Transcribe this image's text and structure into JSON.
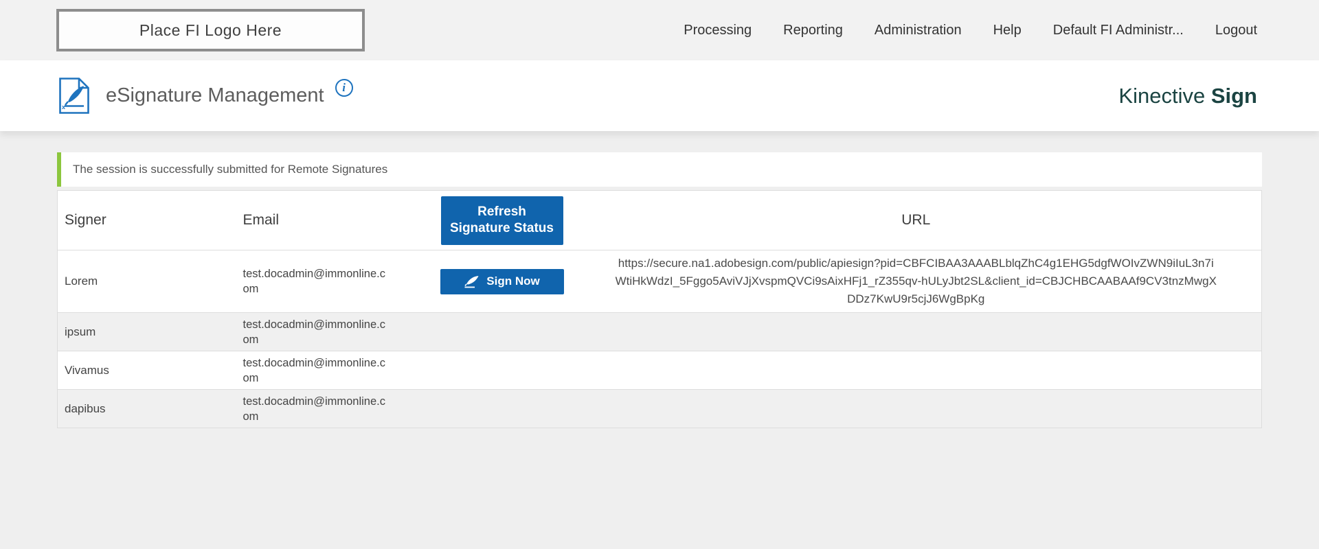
{
  "topbar": {
    "logo_placeholder": "Place FI Logo Here",
    "nav_items": [
      {
        "label": "Processing"
      },
      {
        "label": "Reporting"
      },
      {
        "label": "Administration"
      },
      {
        "label": "Help"
      },
      {
        "label": "Default FI Administr..."
      },
      {
        "label": "Logout"
      }
    ]
  },
  "page_header": {
    "title": "eSignature Management",
    "info_icon_glyph": "i",
    "brand": {
      "name": "Kinective ",
      "product": "Sign"
    }
  },
  "alert": {
    "message": "The session is successfully submitted for Remote Signatures"
  },
  "signers_table": {
    "headers": {
      "signer": "Signer",
      "email": "Email",
      "refresh_button_label": "Refresh Signature Status",
      "url": "URL"
    },
    "rows": [
      {
        "signer": "Lorem",
        "email": "test.docadmin@immonline.com",
        "sign_button_label": "Sign Now",
        "url": "https://secure.na1.adobesign.com/public/apiesign?pid=CBFCIBAA3AAABLblqZhC4g1EHG5dgfWOIvZWN9iIuL3n7iWtiHkWdzI_5Fggo5AviVJjXvspmQVCi9sAixHFj1_rZ355qv-hULyJbt2SL&client_id=CBJCHBCAABAAf9CV3tnzMwgXDDz7KwU9r5cjJ6WgBpKg"
      },
      {
        "signer": "ipsum",
        "email": "test.docadmin@immonline.com",
        "sign_button_label": "",
        "url": ""
      },
      {
        "signer": "Vivamus",
        "email": "test.docadmin@immonline.com",
        "sign_button_label": "",
        "url": ""
      },
      {
        "signer": "dapibus",
        "email": "test.docadmin@immonline.com",
        "sign_button_label": "",
        "url": ""
      }
    ]
  },
  "colors": {
    "button_blue": "#1064ad",
    "icon_blue": "#1e73be",
    "success_green": "#8cc63e",
    "brand_teal": "#1b4442"
  }
}
